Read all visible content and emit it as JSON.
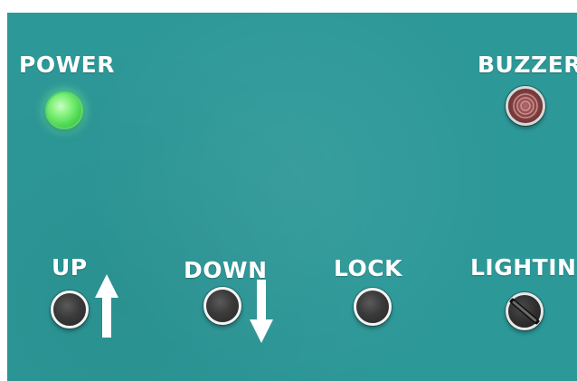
{
  "panel": {
    "background_color": "#2d9898",
    "labels": {
      "power": "POWER",
      "buzzer": "BUZZER",
      "up": "UP",
      "down": "DOWN",
      "lock": "LOCK",
      "lighting": "LIGHTING"
    },
    "indicators": {
      "power_led_color": "#6fe86a",
      "buzzer_color": "#8c4848"
    },
    "icons": {
      "up": "arrow-up-icon",
      "down": "arrow-down-icon",
      "lighting": "selector-switch-icon"
    }
  }
}
